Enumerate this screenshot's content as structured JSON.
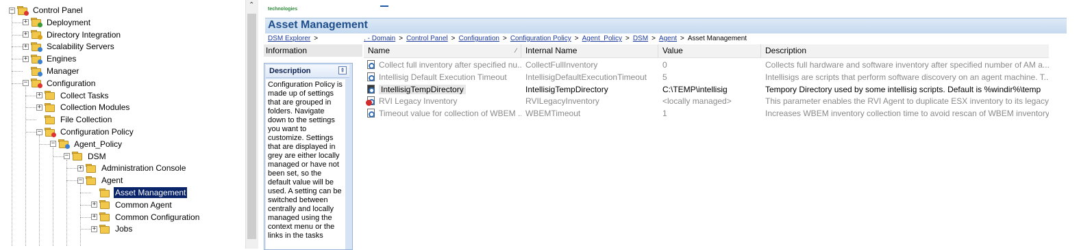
{
  "tree": {
    "items": [
      {
        "label": "Control Panel",
        "level": 0,
        "expander": "−",
        "icon": "control-panel-icon"
      },
      {
        "label": "Deployment",
        "level": 1,
        "expander": "+",
        "icon": "deployment-icon"
      },
      {
        "label": "Directory Integration",
        "level": 1,
        "expander": "+",
        "icon": "directory-icon"
      },
      {
        "label": "Scalability Servers",
        "level": 1,
        "expander": "+",
        "icon": "servers-icon"
      },
      {
        "label": "Engines",
        "level": 1,
        "expander": "+",
        "icon": "engines-icon"
      },
      {
        "label": "Manager",
        "level": 1,
        "expander": "",
        "icon": "manager-icon"
      },
      {
        "label": "Configuration",
        "level": 1,
        "expander": "−",
        "icon": "configuration-icon"
      },
      {
        "label": "Collect Tasks",
        "level": 2,
        "expander": "+",
        "icon": "folder-icon"
      },
      {
        "label": "Collection Modules",
        "level": 2,
        "expander": "+",
        "icon": "folder-icon"
      },
      {
        "label": "File Collection",
        "level": 2,
        "expander": "",
        "icon": "folder-icon"
      },
      {
        "label": "Configuration Policy",
        "level": 2,
        "expander": "−",
        "icon": "policy-folder-icon"
      },
      {
        "label": "Agent_Policy",
        "level": 3,
        "expander": "−",
        "icon": "policy-icon"
      },
      {
        "label": "DSM",
        "level": 4,
        "expander": "−",
        "icon": "folder-icon"
      },
      {
        "label": "Administration Console",
        "level": 5,
        "expander": "+",
        "icon": "folder-icon"
      },
      {
        "label": "Agent",
        "level": 5,
        "expander": "−",
        "icon": "folder-icon"
      },
      {
        "label": "Asset Management",
        "level": 6,
        "expander": "",
        "icon": "folder-icon",
        "selected": true
      },
      {
        "label": "Common Agent",
        "level": 6,
        "expander": "+",
        "icon": "folder-icon"
      },
      {
        "label": "Common Configuration",
        "level": 6,
        "expander": "+",
        "icon": "folder-icon"
      },
      {
        "label": "Jobs",
        "level": 6,
        "expander": "+",
        "icon": "folder-icon"
      }
    ]
  },
  "logo": {
    "text": "technologies"
  },
  "page": {
    "title": "Asset Management"
  },
  "breadcrumb": {
    "links": [
      "DSM Explorer",
      ". - Domain",
      "Control Panel",
      "Configuration",
      "Configuration Policy",
      "Agent_Policy",
      "DSM",
      "Agent"
    ],
    "current": "Asset Management",
    "separator": ">"
  },
  "info": {
    "header": "Information",
    "description_title": "Description",
    "description_text": "Configuration Policy is made up of settings that are grouped in folders. Navigate down to the settings you want to customize. Settings that are displayed in grey are either locally managed or have not been set, so the default value will be used. A setting can be switched between centrally and locally managed using the context menu or the links in the tasks"
  },
  "grid": {
    "columns": [
      "Name",
      "Internal Name",
      "Value",
      "Description"
    ],
    "sort_indicator": "⁄",
    "rows": [
      {
        "name": "Collect full inventory after specified nu...",
        "internal": "CollectFullInventory",
        "value": "0",
        "description": "Collects full hardware and software inventory after specified number of AM a...",
        "style": "grey",
        "icon": "setting-icon"
      },
      {
        "name": "Intellisig Default Execution Timeout",
        "internal": "IntellisigDefaultExecutionTimeout",
        "value": "5",
        "description": "Intellisigs are scripts that perform software discovery on an agent machine. T...",
        "style": "grey",
        "icon": "setting-icon"
      },
      {
        "name": "IntellisigTempDirectory",
        "internal": "IntellisigTempDirectory",
        "value": "C:\\TEMP\\intellisig",
        "description": "Tempory Directory used by some intellisig scripts. Default is %windir%\\temp",
        "style": "act",
        "icon": "setting-active-icon"
      },
      {
        "name": "RVI Legacy Inventory",
        "internal": "RVILegacyInventory",
        "value": "<locally managed>",
        "description": "This parameter enables the RVI Agent to duplicate ESX inventory to its legacy ...",
        "style": "grey",
        "icon": "setting-locally-managed-icon"
      },
      {
        "name": "Timeout value for collection of WBEM ...",
        "internal": "WBEMTimeout",
        "value": "1",
        "description": "Increases WBEM inventory collection time to avoid rescan of WBEM inventory...",
        "style": "grey",
        "icon": "setting-icon"
      }
    ]
  },
  "colors": {
    "title": "#1f4e8c",
    "link": "#1a3aa0",
    "selection": "#0a246a",
    "grey_text": "#8a8a8a"
  }
}
